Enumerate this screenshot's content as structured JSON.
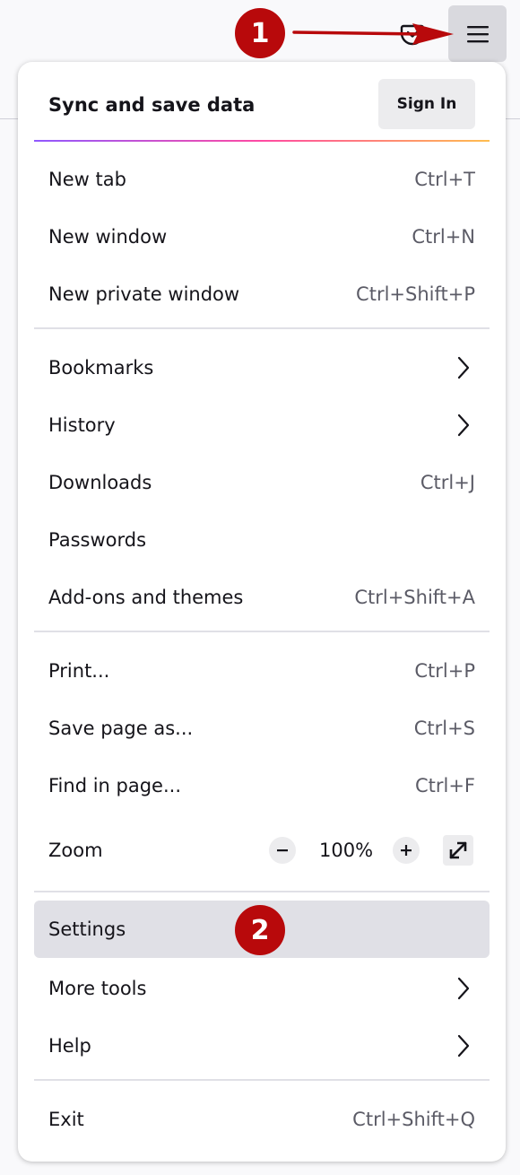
{
  "toolbar": {
    "pocket_icon": "pocket-icon",
    "menu_icon": "hamburger-menu-icon"
  },
  "callouts": {
    "one": "1",
    "two": "2",
    "color": "#b8090b"
  },
  "sync": {
    "title": "Sync and save data",
    "signin_label": "Sign In"
  },
  "menu": {
    "new_tab": {
      "label": "New tab",
      "shortcut": "Ctrl+T"
    },
    "new_window": {
      "label": "New window",
      "shortcut": "Ctrl+N"
    },
    "new_private_window": {
      "label": "New private window",
      "shortcut": "Ctrl+Shift+P"
    },
    "bookmarks": {
      "label": "Bookmarks"
    },
    "history": {
      "label": "History"
    },
    "downloads": {
      "label": "Downloads",
      "shortcut": "Ctrl+J"
    },
    "passwords": {
      "label": "Passwords"
    },
    "addons": {
      "label": "Add-ons and themes",
      "shortcut": "Ctrl+Shift+A"
    },
    "print": {
      "label": "Print...",
      "shortcut": "Ctrl+P"
    },
    "save_page": {
      "label": "Save page as...",
      "shortcut": "Ctrl+S"
    },
    "find": {
      "label": "Find in page...",
      "shortcut": "Ctrl+F"
    },
    "zoom": {
      "label": "Zoom",
      "value": "100%"
    },
    "settings": {
      "label": "Settings"
    },
    "more_tools": {
      "label": "More tools"
    },
    "help": {
      "label": "Help"
    },
    "exit": {
      "label": "Exit",
      "shortcut": "Ctrl+Shift+Q"
    }
  }
}
